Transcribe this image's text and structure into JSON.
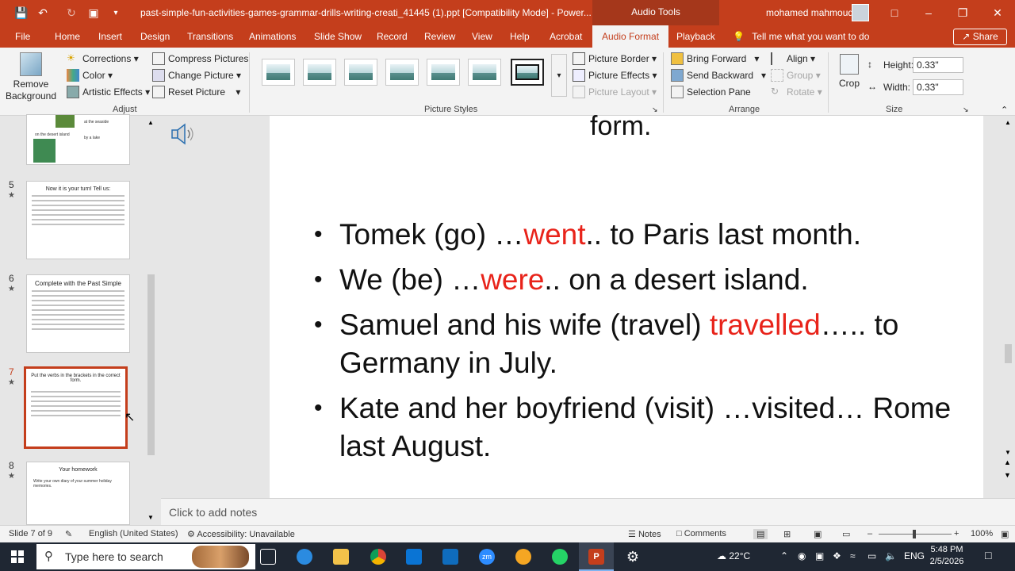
{
  "titlebar": {
    "doc_title": "past-simple-fun-activities-games-grammar-drills-writing-creati_41445 (1).ppt [Compatibility Mode]  -  Power...",
    "context_tab": "Audio Tools",
    "user": "mohamed mahmoud",
    "accent_color": "#c43e1c"
  },
  "tabs": [
    "File",
    "Home",
    "Insert",
    "Design",
    "Transitions",
    "Animations",
    "Slide Show",
    "Record",
    "Review",
    "View",
    "Help",
    "Acrobat",
    "Audio Format",
    "Playback"
  ],
  "tell_me": "Tell me what you want to do",
  "share": "Share",
  "ribbon": {
    "adjust": {
      "remove_bg": "Remove Background",
      "corrections": "Corrections",
      "color": "Color",
      "artistic": "Artistic Effects",
      "compress": "Compress Pictures",
      "change": "Change Picture",
      "reset": "Reset Picture",
      "label": "Adjust"
    },
    "styles": {
      "border": "Picture Border",
      "effects": "Picture Effects",
      "layout": "Picture Layout",
      "label": "Picture Styles"
    },
    "arrange": {
      "bring_forward": "Bring Forward",
      "send_backward": "Send Backward",
      "selection_pane": "Selection Pane",
      "align": "Align",
      "group": "Group",
      "rotate": "Rotate",
      "label": "Arrange"
    },
    "size": {
      "crop": "Crop",
      "height_label": "Height:",
      "height_value": "0.33\"",
      "width_label": "Width:",
      "width_value": "0.33\"",
      "label": "Size"
    }
  },
  "thumbnails": [
    {
      "num": "5",
      "title": "Now it is your turn! Tell us:"
    },
    {
      "num": "6",
      "title": "Complete with the Past Simple"
    },
    {
      "num": "7",
      "title": "Put the verbs in the brackets in the correct form."
    },
    {
      "num": "8",
      "title": "Your homework",
      "sub": "Write your own diary of your summer holiday memories."
    }
  ],
  "thumb4_labels": [
    "at the seaside",
    "by a lake",
    "on the desert island"
  ],
  "slide": {
    "heading_tail": "form.",
    "bullets": [
      {
        "pre": "Tomek (go) …",
        "ans": "went",
        "post": ".. to Paris last month."
      },
      {
        "pre": "We (be) …",
        "ans": "were",
        "post": ".. on a desert island."
      },
      {
        "pre": "Samuel and his wife (travel) ",
        "ans": "travelled",
        "post": "….. to Germany in July."
      },
      {
        "pre": "Kate and her boyfriend (visit) …visited… Rome last August.",
        "ans": "",
        "post": ""
      }
    ]
  },
  "notes_placeholder": "Click to add notes",
  "status": {
    "slide": "Slide 7 of 9",
    "language": "English (United States)",
    "accessibility": "Accessibility: Unavailable",
    "notes": "Notes",
    "comments": "Comments",
    "zoom": "100%"
  },
  "taskbar": {
    "search": "Type here to search",
    "temp": "22°C",
    "lang": "ENG",
    "time": "5:48 PM",
    "date": "2/5/2026"
  }
}
